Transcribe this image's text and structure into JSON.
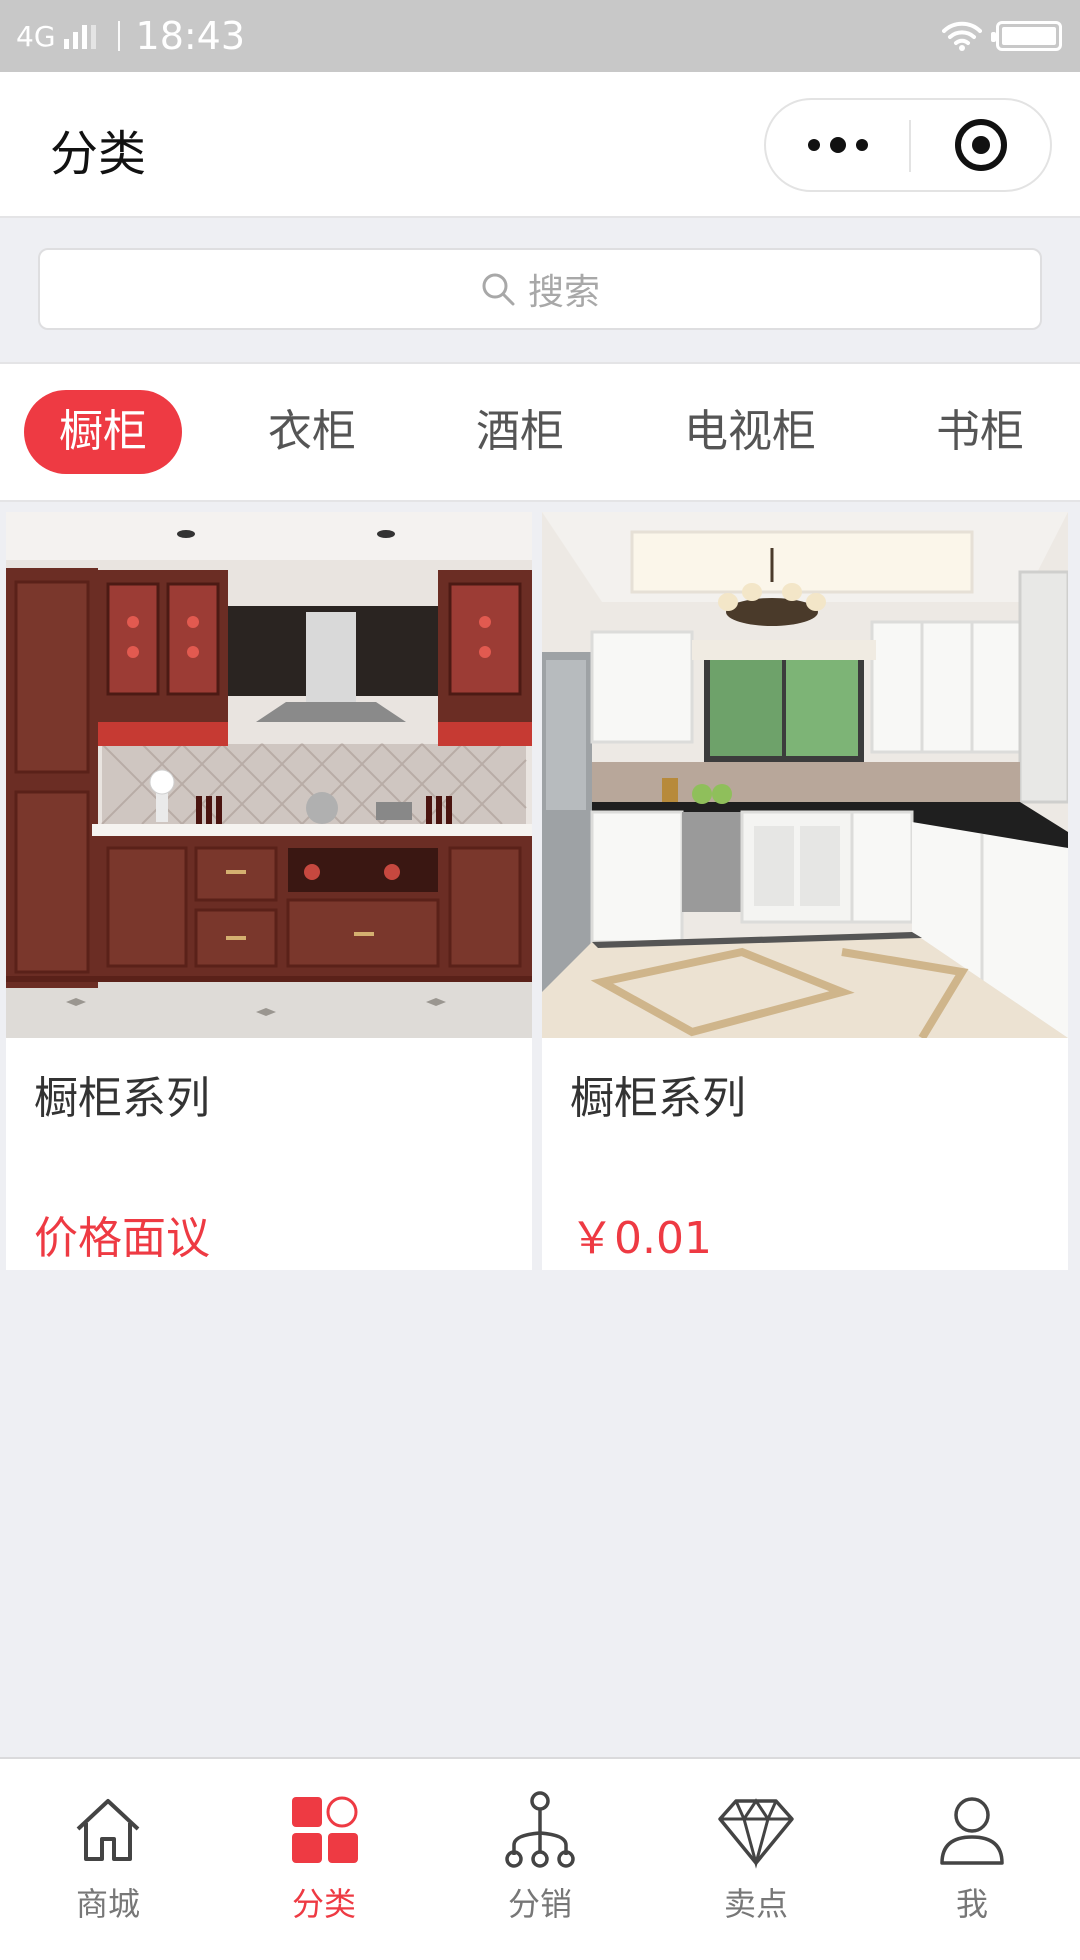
{
  "status_bar": {
    "network": "4G",
    "time": "18:43"
  },
  "nav": {
    "title": "分类"
  },
  "search": {
    "placeholder": "搜索"
  },
  "categories": [
    {
      "label": "橱柜",
      "active": true
    },
    {
      "label": "衣柜",
      "active": false
    },
    {
      "label": "酒柜",
      "active": false
    },
    {
      "label": "电视柜",
      "active": false
    },
    {
      "label": "书柜",
      "active": false
    }
  ],
  "products": [
    {
      "name": "橱柜系列",
      "price": "价格面议"
    },
    {
      "name": "橱柜系列",
      "price": "￥0.01"
    }
  ],
  "tabbar": [
    {
      "label": "商城",
      "icon": "home-icon",
      "active": false
    },
    {
      "label": "分类",
      "icon": "category-icon",
      "active": true
    },
    {
      "label": "分销",
      "icon": "distribution-icon",
      "active": false
    },
    {
      "label": "卖点",
      "icon": "diamond-icon",
      "active": false
    },
    {
      "label": "我",
      "icon": "user-icon",
      "active": false
    }
  ],
  "colors": {
    "accent": "#ee3a43",
    "status_bar": "#c8c8c8",
    "background": "#eeeff3"
  }
}
